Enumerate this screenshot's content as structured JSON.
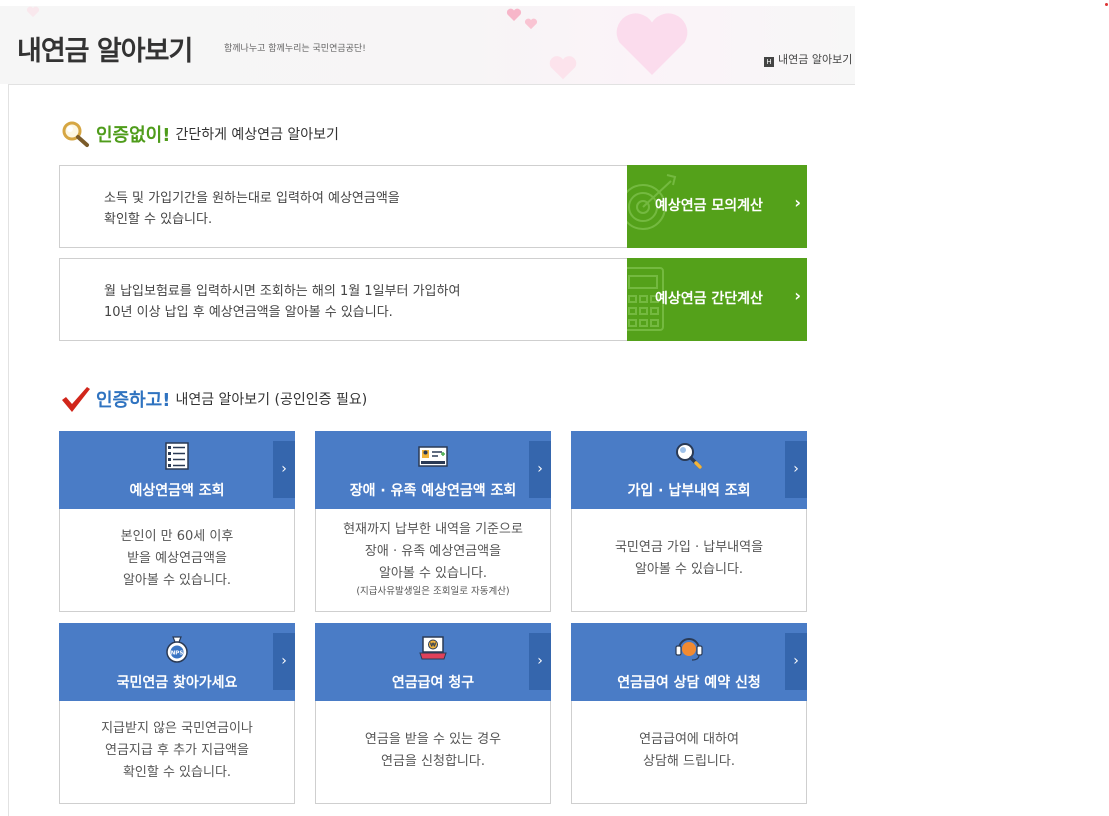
{
  "header": {
    "title": "내연금 알아보기",
    "slogan": "함께나누고 함께누리는 국민연금공단!",
    "breadcrumb": "내연금 알아보기"
  },
  "no_auth": {
    "emphasis": "인증없이!",
    "rest": "간단하게 예상연금 알아보기",
    "rows": [
      {
        "desc": [
          "소득 및 가입기간을 원하는대로 입력하여 예상연금액을",
          "확인할 수 있습니다."
        ],
        "button": "예상연금 모의계산"
      },
      {
        "desc": [
          "월 납입보험료를 입력하시면 조회하는 해의 1월 1일부터 가입하여",
          "10년 이상 납입 후 예상연금액을 알아볼 수 있습니다."
        ],
        "button": "예상연금 간단계산"
      }
    ]
  },
  "auth": {
    "emphasis": "인증하고!",
    "rest": "내연금 알아보기 (공인인증 필요)",
    "cards": [
      {
        "icon": "document-list-icon",
        "title": "예상연금액 조회",
        "desc": [
          "본인이 만 60세 이후",
          "받을 예상연금액을",
          "알아볼 수 있습니다."
        ],
        "note": ""
      },
      {
        "icon": "id-card-icon",
        "title": "장애 · 유족 예상연금액 조회",
        "desc": [
          "현재까지 납부한 내역을 기준으로",
          "장애 · 유족 예상연금액을",
          "알아볼 수 있습니다."
        ],
        "note": "(지급사유발생일은 조회일로 자동계산)"
      },
      {
        "icon": "magnifier-icon",
        "title": "가입 · 납부내역 조회",
        "desc": [
          "국민연금 가입 · 납부내역을",
          "알아볼 수 있습니다."
        ],
        "note": ""
      },
      {
        "icon": "nps-pouch-icon",
        "title": "국민연금 찾아가세요",
        "desc": [
          "지급받지 않은 국민연금이나",
          "연금지급 후 추가 지급액을",
          "확인할 수 있습니다."
        ],
        "note": ""
      },
      {
        "icon": "money-laptop-icon",
        "title": "연금급여 청구",
        "desc": [
          "연금을 받을 수 있는 경우",
          "연금을 신청합니다."
        ],
        "note": ""
      },
      {
        "icon": "headset-icon",
        "title": "연금급여 상담 예약 신청",
        "desc": [
          "연금급여에 대하여",
          "상담해 드립니다."
        ],
        "note": ""
      }
    ]
  },
  "arrow": "›",
  "home_glyph": "H",
  "colors": {
    "green": "#54a11a",
    "blue": "#4a7cc6",
    "blue_dark": "#3566ad",
    "emph_green": "#4f9c1b",
    "emph_blue": "#2f73c0"
  }
}
